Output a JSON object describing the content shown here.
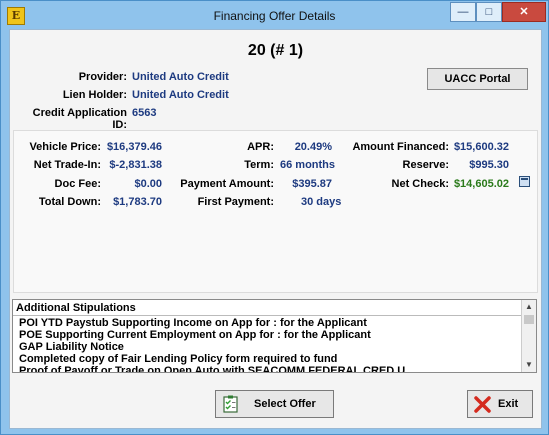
{
  "window": {
    "title": "Financing Offer Details",
    "minimize": "—",
    "maximize": "□",
    "close": "✕",
    "app_icon": "E"
  },
  "offer": {
    "heading": "20 (# 1)"
  },
  "info": {
    "provider_label": "Provider:",
    "provider_value": "United Auto Credit",
    "lien_label": "Lien Holder:",
    "lien_value": "United Auto Credit",
    "credit_label": "Credit Application ID:",
    "credit_value": "6563"
  },
  "portal_button": "UACC Portal",
  "details": {
    "col1": [
      {
        "label": "Vehicle Price:",
        "value": "$16,379.46"
      },
      {
        "label": "Net Trade-In:",
        "value": "$-2,831.38"
      },
      {
        "label": "Doc Fee:",
        "value": "$0.00"
      },
      {
        "label": "Total Down:",
        "value": "$1,783.70"
      }
    ],
    "col2": [
      {
        "label": "APR:",
        "value": "20.49%"
      },
      {
        "label": "Term:",
        "value": "66 months"
      },
      {
        "label": "Payment Amount:",
        "value": "$395.87"
      },
      {
        "label": "First Payment:",
        "value": "30 days"
      }
    ],
    "col3": [
      {
        "label": "Amount Financed:",
        "value": "$15,600.32"
      },
      {
        "label": "Reserve:",
        "value": "$995.30"
      },
      {
        "label": "Net Check:",
        "value": "$14,605.02"
      }
    ]
  },
  "stipulations": {
    "header": "Additional Stipulations",
    "items": [
      "POI YTD Paystub Supporting Income on App for            : for the Applicant",
      "POE Supporting Current Employment on App for            : for the Applicant",
      "GAP Liability Notice",
      "Completed copy of Fair Lending Policy form required to fund",
      "Proof of Payoff or Trade on Open Auto with SEACOMM FEDERAL CRED U"
    ]
  },
  "buttons": {
    "select": "Select Offer",
    "exit": "Exit"
  },
  "colors": {
    "value_blue": "#1d3a80",
    "value_green": "#2a7a1a",
    "title_bar": "#8fc3ec"
  },
  "icons": {
    "select": "checklist-icon",
    "exit": "red-x-icon",
    "calc": "calculator-icon"
  }
}
